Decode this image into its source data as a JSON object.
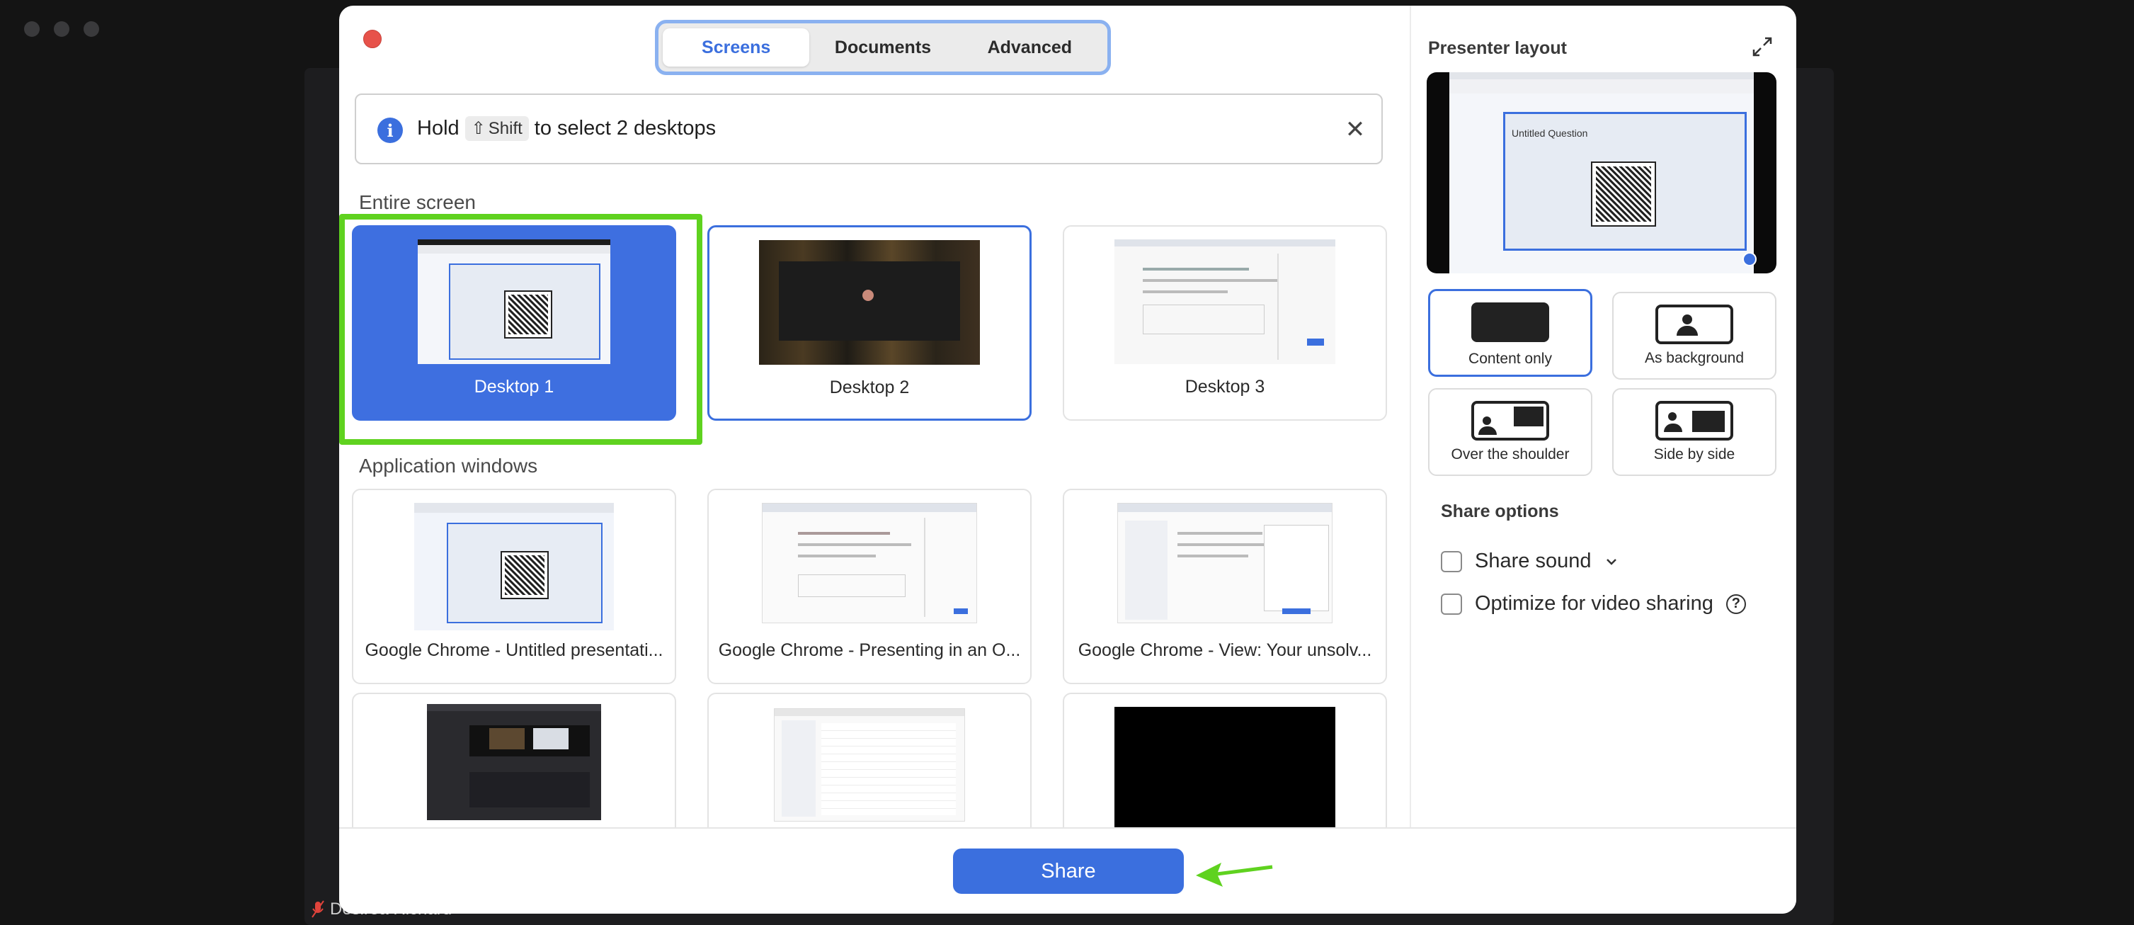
{
  "background": {
    "participant_name": "Desirea Richard"
  },
  "tabs": [
    {
      "label": "Screens",
      "active": true
    },
    {
      "label": "Documents",
      "active": false
    },
    {
      "label": "Advanced",
      "active": false
    }
  ],
  "notice": {
    "before": "Hold",
    "key": "Shift",
    "key_symbol": "⇧",
    "after": "to select 2 desktops",
    "icon": "info-icon"
  },
  "sections": {
    "entire_screen": "Entire screen",
    "application_windows": "Application windows"
  },
  "desktops": [
    {
      "label": "Desktop 1",
      "selected": true
    },
    {
      "label": "Desktop 2",
      "selected": false
    },
    {
      "label": "Desktop 3",
      "selected": false
    }
  ],
  "apps": [
    {
      "label": "Google Chrome - Untitled presentati..."
    },
    {
      "label": "Google Chrome - Presenting in an O..."
    },
    {
      "label": "Google Chrome - View: Your unsolv..."
    },
    {
      "label": ""
    },
    {
      "label": ""
    },
    {
      "label": ""
    }
  ],
  "right_panel": {
    "presenter_title": "Presenter layout",
    "preview_slide_title": "Untitled Question",
    "layouts": [
      {
        "label": "Content only",
        "active": true
      },
      {
        "label": "As background",
        "active": false
      },
      {
        "label": "Over the shoulder",
        "active": false
      },
      {
        "label": "Side by side",
        "active": false
      }
    ],
    "share_options_title": "Share options",
    "share_sound": "Share sound",
    "optimize_video": "Optimize for video sharing"
  },
  "footer": {
    "share_label": "Share"
  },
  "colors": {
    "accent": "#3b6fde",
    "highlight": "#5fd21f",
    "close": "#e7524a"
  }
}
